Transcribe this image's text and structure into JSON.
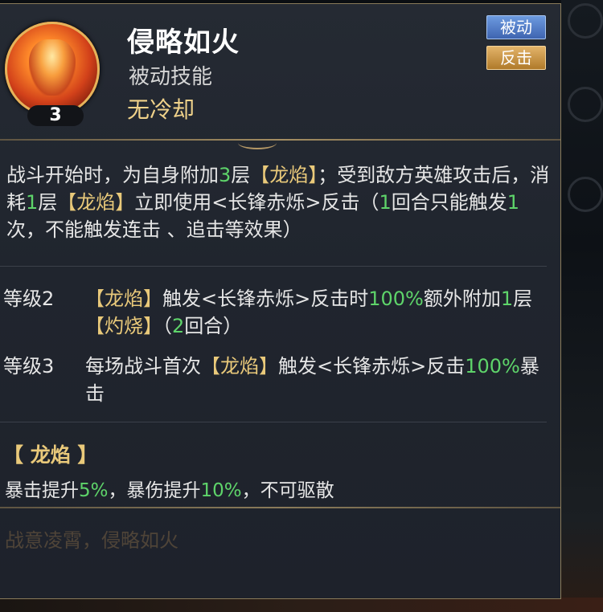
{
  "skill": {
    "name": "侵略如火",
    "type": "被动技能",
    "cooldown": "无冷却",
    "level": "3",
    "icon": "fire-warrior-portrait-icon",
    "tags": [
      "被动",
      "反击"
    ]
  },
  "description": [
    {
      "t": "战斗开始时，为自身附加",
      "c": ""
    },
    {
      "t": "3",
      "c": "g"
    },
    {
      "t": "层",
      "c": ""
    },
    {
      "t": "【龙焰】",
      "c": "y"
    },
    {
      "t": "；受到敌方英雄攻击后，消耗",
      "c": ""
    },
    {
      "t": "1",
      "c": "g"
    },
    {
      "t": "层",
      "c": ""
    },
    {
      "t": "【龙焰】",
      "c": "y"
    },
    {
      "t": "立即使用<长锋赤烁>反击（",
      "c": ""
    },
    {
      "t": "1",
      "c": "g"
    },
    {
      "t": "回合只能触发",
      "c": ""
    },
    {
      "t": "1",
      "c": "g"
    },
    {
      "t": "次，不能触发连击 、追击等效果）",
      "c": ""
    }
  ],
  "levels": [
    {
      "label": "等级2",
      "parts": [
        {
          "t": "【龙焰】",
          "c": "y"
        },
        {
          "t": "触发<长锋赤烁>反击时",
          "c": ""
        },
        {
          "t": "100%",
          "c": "g"
        },
        {
          "t": "额外附加",
          "c": ""
        },
        {
          "t": "1",
          "c": "g"
        },
        {
          "t": "层",
          "c": ""
        },
        {
          "t": "【灼烧】",
          "c": "y"
        },
        {
          "t": "（",
          "c": ""
        },
        {
          "t": "2",
          "c": "g"
        },
        {
          "t": "回合）",
          "c": ""
        }
      ]
    },
    {
      "label": "等级3",
      "parts": [
        {
          "t": "每场战斗首次",
          "c": ""
        },
        {
          "t": "【龙焰】",
          "c": "y"
        },
        {
          "t": "触发<长锋赤烁>反击",
          "c": ""
        },
        {
          "t": "100%",
          "c": "g"
        },
        {
          "t": "暴击",
          "c": ""
        }
      ]
    }
  ],
  "buff": {
    "name": "【 龙焰 】",
    "parts": [
      {
        "t": "暴击提升",
        "c": ""
      },
      {
        "t": "5%",
        "c": "g"
      },
      {
        "t": "，暴伤提升",
        "c": ""
      },
      {
        "t": "10%",
        "c": "g"
      },
      {
        "t": "，不可驱散",
        "c": ""
      }
    ]
  },
  "flavor": "战意凌霄，侵略如火",
  "colors": {
    "highlight_green": "#5ed46a",
    "highlight_gold": "#e9c97a",
    "tag_blue": "#3e64b0",
    "tag_orange": "#b07a2a"
  }
}
